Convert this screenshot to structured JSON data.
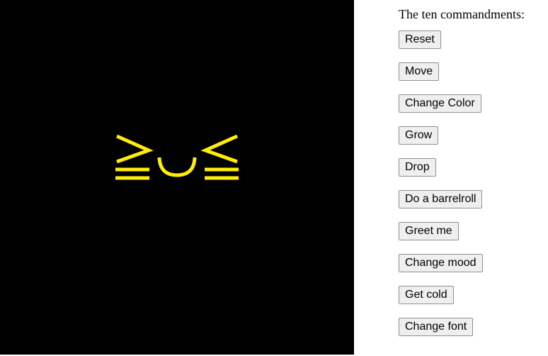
{
  "stage": {
    "background_color": "#000000",
    "face_color": "#ffee00",
    "face_expression": "≧◡≦"
  },
  "panel": {
    "heading": "The ten commandments:",
    "buttons": [
      {
        "label": "Reset"
      },
      {
        "label": "Move"
      },
      {
        "label": "Change Color"
      },
      {
        "label": "Grow"
      },
      {
        "label": "Drop"
      },
      {
        "label": "Do a barrelroll"
      },
      {
        "label": "Greet me"
      },
      {
        "label": "Change mood"
      },
      {
        "label": "Get cold"
      },
      {
        "label": "Change font"
      }
    ]
  }
}
